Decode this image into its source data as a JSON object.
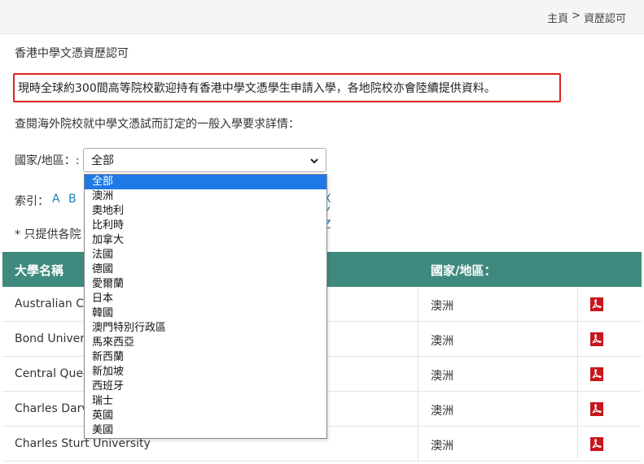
{
  "breadcrumb": {
    "home": "主頁",
    "separator": ">",
    "current": "資歷認可"
  },
  "page_title": "香港中學文憑資歷認可",
  "notice": "現時全球約300間高等院校歡迎持有香港中學文憑學生申請入學，各地院校亦會陸續提供資料。",
  "intro": "查閱海外院校就中學文憑試而訂定的一般入學要求詳情：",
  "filter": {
    "label": "國家/地區：:",
    "selected": "全部",
    "options": [
      "全部",
      "澳洲",
      "奧地利",
      "比利時",
      "加拿大",
      "法國",
      "德國",
      "愛爾蘭",
      "日本",
      "韓國",
      "澳門特別行政區",
      "馬來西亞",
      "新西蘭",
      "新加坡",
      "西班牙",
      "瑞士",
      "英國",
      "美國"
    ]
  },
  "index": {
    "label": "索引：",
    "letters_left": "A B C",
    "letters_right": "X Y Z"
  },
  "footnote": "* 只提供各院",
  "table": {
    "headers": {
      "name": "大學名稱",
      "country": "國家/地區："
    },
    "rows": [
      {
        "name": "Australian Ca",
        "country": "澳洲"
      },
      {
        "name": "Bond Univers",
        "country": "澳洲"
      },
      {
        "name": "Central Quee",
        "country": "澳洲"
      },
      {
        "name": "Charles Darv",
        "country": "澳洲"
      },
      {
        "name": "Charles Sturt University",
        "country": "澳洲"
      }
    ]
  },
  "icons": {
    "pdf": "pdf-icon",
    "chevron": "chevron-down-icon"
  },
  "colors": {
    "header_bg": "#3f8a7f",
    "notice_border": "#e02020",
    "link": "#1a7fbf",
    "selected_option": "#1e79e6",
    "pdf_red": "#c8161d"
  }
}
